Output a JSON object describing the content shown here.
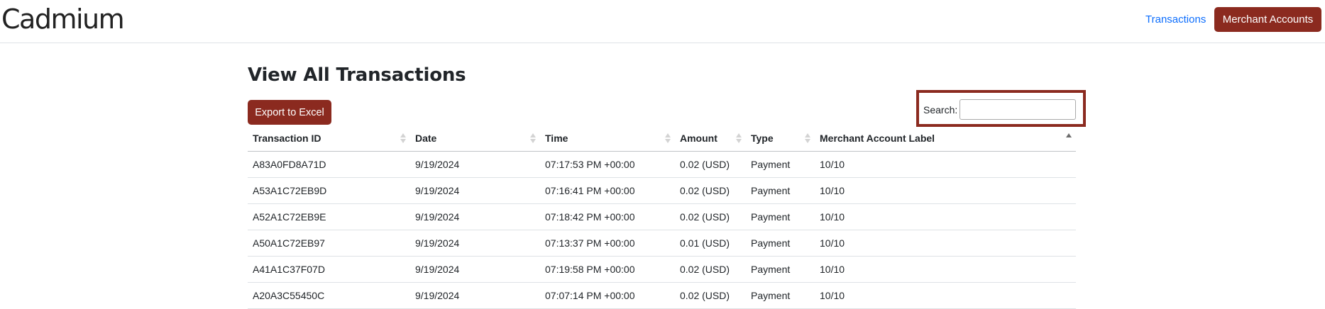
{
  "brand": "Cadmium",
  "nav": {
    "transactions_link": "Transactions",
    "merchant_accounts_button": "Merchant Accounts"
  },
  "page": {
    "title": "View All Transactions",
    "export_button": "Export to Excel"
  },
  "search": {
    "label": "Search:",
    "value": ""
  },
  "table": {
    "columns": [
      {
        "label": "Transaction ID",
        "sort": "none"
      },
      {
        "label": "Date",
        "sort": "none"
      },
      {
        "label": "Time",
        "sort": "none"
      },
      {
        "label": "Amount",
        "sort": "none"
      },
      {
        "label": "Type",
        "sort": "none"
      },
      {
        "label": "Merchant Account Label",
        "sort": "ascending"
      }
    ],
    "rows": [
      [
        "A83A0FD8A71D",
        "9/19/2024",
        "07:17:53 PM +00:00",
        "0.02 (USD)",
        "Payment",
        "10/10"
      ],
      [
        "A53A1C72EB9D",
        "9/19/2024",
        "07:16:41 PM +00:00",
        "0.02 (USD)",
        "Payment",
        "10/10"
      ],
      [
        "A52A1C72EB9E",
        "9/19/2024",
        "07:18:42 PM +00:00",
        "0.02 (USD)",
        "Payment",
        "10/10"
      ],
      [
        "A50A1C72EB97",
        "9/19/2024",
        "07:13:37 PM +00:00",
        "0.01 (USD)",
        "Payment",
        "10/10"
      ],
      [
        "A41A1C37F07D",
        "9/19/2024",
        "07:19:58 PM +00:00",
        "0.02 (USD)",
        "Payment",
        "10/10"
      ],
      [
        "A20A3C55450C",
        "9/19/2024",
        "07:07:14 PM +00:00",
        "0.02 (USD)",
        "Payment",
        "10/10"
      ]
    ]
  },
  "colors": {
    "accent": "#8b2a1f",
    "link": "#0d6efd"
  }
}
